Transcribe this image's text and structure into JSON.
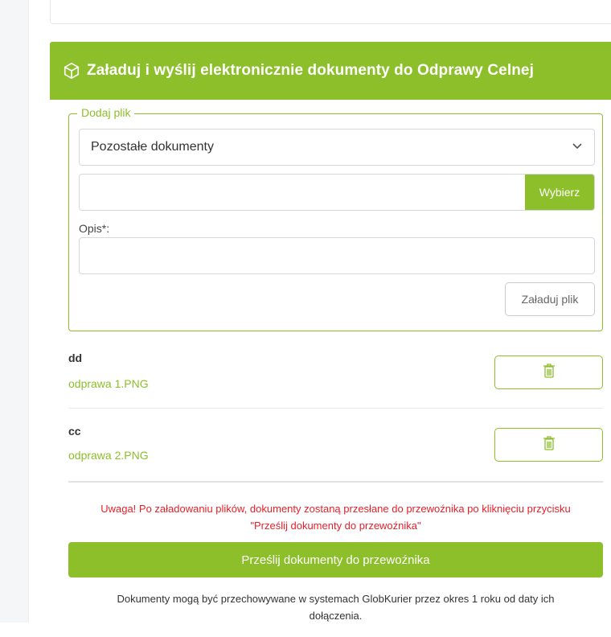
{
  "panel": {
    "title": "Załaduj i wyślij elektronicznie dokumenty do Odprawy Celnej",
    "title_icon": "cube-icon"
  },
  "form": {
    "legend": "Dodaj plik",
    "document_type": {
      "selected": "Pozostałe dokumenty",
      "icon": "chevron-down-icon"
    },
    "file_input": {
      "value": "",
      "choose_label": "Wybierz"
    },
    "description": {
      "label": "Opis*:",
      "value": ""
    },
    "upload_label": "Załaduj plik"
  },
  "files": [
    {
      "name": "dd",
      "file": "odprawa 1.PNG",
      "delete_icon": "trash-icon"
    },
    {
      "name": "cc",
      "file": "odprawa 2.PNG",
      "delete_icon": "trash-icon"
    }
  ],
  "warning": {
    "line1": "Uwaga! Po załadowaniu plików, dokumenty zostaną przesłane do przewoźnika po kliknięciu przycisku",
    "line2": "\"Prześlij dokumenty do przewoźnika\""
  },
  "send_label": "Prześlij dokumenty do przewoźnika",
  "note": {
    "line1": "Dokumenty mogą być przechowywane w systemach GlobKurier przez okres 1 roku od daty ich",
    "line2": "dołączenia."
  },
  "colors": {
    "accent": "#8cbf2a",
    "warning": "#e8202a"
  }
}
